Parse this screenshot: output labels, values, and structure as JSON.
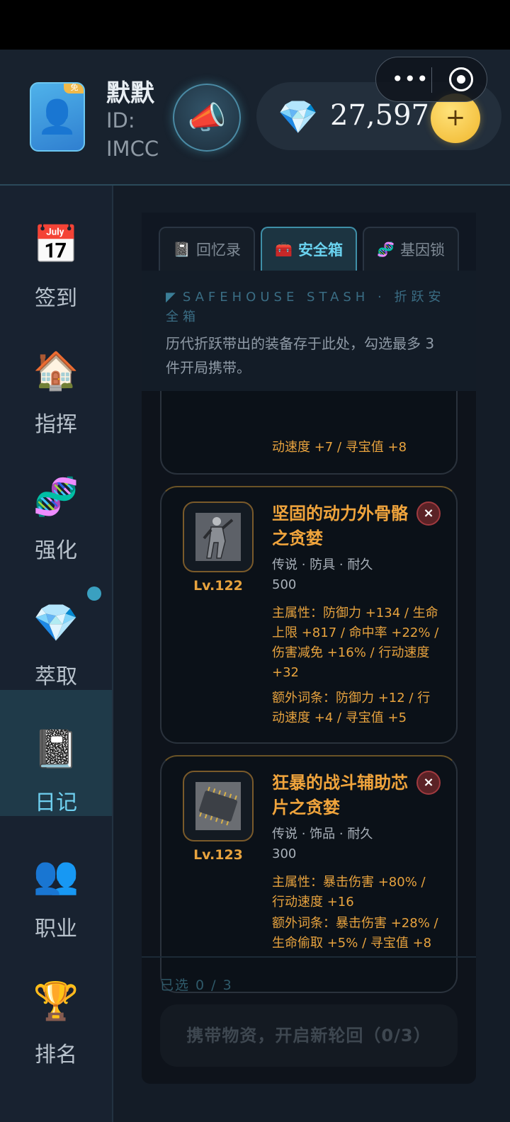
{
  "header": {
    "username": "默默",
    "user_id": "ID: IMCC",
    "avatar_badge": "免",
    "gem_count": "27,597",
    "plus_label": "+",
    "capsule_more": "•••"
  },
  "sidebar": {
    "items": [
      {
        "label": "签到",
        "icon": "calendar-icon",
        "glyph": "📅"
      },
      {
        "label": "指挥",
        "icon": "house-icon",
        "glyph": "🏠"
      },
      {
        "label": "强化",
        "icon": "dna-icon",
        "glyph": "🧬"
      },
      {
        "label": "萃取",
        "icon": "gem-icon",
        "glyph": "💎"
      },
      {
        "label": "日记",
        "icon": "notebook-icon",
        "glyph": "📓",
        "active": true
      },
      {
        "label": "职业",
        "icon": "people-icon",
        "glyph": "👥"
      },
      {
        "label": "排名",
        "icon": "trophy-icon",
        "glyph": "🏆"
      }
    ]
  },
  "tabs": [
    {
      "label": "回忆录",
      "icon": "notebook-icon",
      "glyph": "📓"
    },
    {
      "label": "安全箱",
      "icon": "toolbox-icon",
      "glyph": "🧰",
      "active": true
    },
    {
      "label": "基因锁",
      "icon": "dna-icon",
      "glyph": "🧬"
    }
  ],
  "intro": {
    "flag": "◤",
    "title": "SAFEHOUSE STASH · 折跃安全箱",
    "desc": "历代折跃带出的装备存于此处，勾选最多 3 件开局携带。"
  },
  "cards": [
    {
      "partial_line": "动速度 +7 / 寻宝值 +8"
    },
    {
      "name": "坚固的动力外骨骼之贪婪",
      "level": "Lv.122",
      "meta": "传说 · 防具 · 耐久 500",
      "main": "主属性：防御力 +134 / 生命上限 +817 / 命中率 +22% / 伤害减免 +16% / 行动速度 +32",
      "extra": "额外词条：防御力 +12 / 行动速度 +4 / 寻宝值 +5",
      "close": "×"
    },
    {
      "name": "狂暴的战斗辅助芯片之贪婪",
      "level": "Lv.123",
      "meta": "传说 · 饰品 · 耐久 300",
      "main": "主属性：暴击伤害 +80% / 行动速度 +16",
      "extra": "额外词条：暴击伤害 +28% / 生命偷取 +5% / 寻宝值 +8",
      "close": "×"
    }
  ],
  "footer": {
    "selected": "已选 0 / 3",
    "cta": "携带物资，开启新轮回（0/3）"
  },
  "colors": {
    "accent": "#6ad3f0",
    "gold": "#e8a33e",
    "background": "#141c27"
  }
}
